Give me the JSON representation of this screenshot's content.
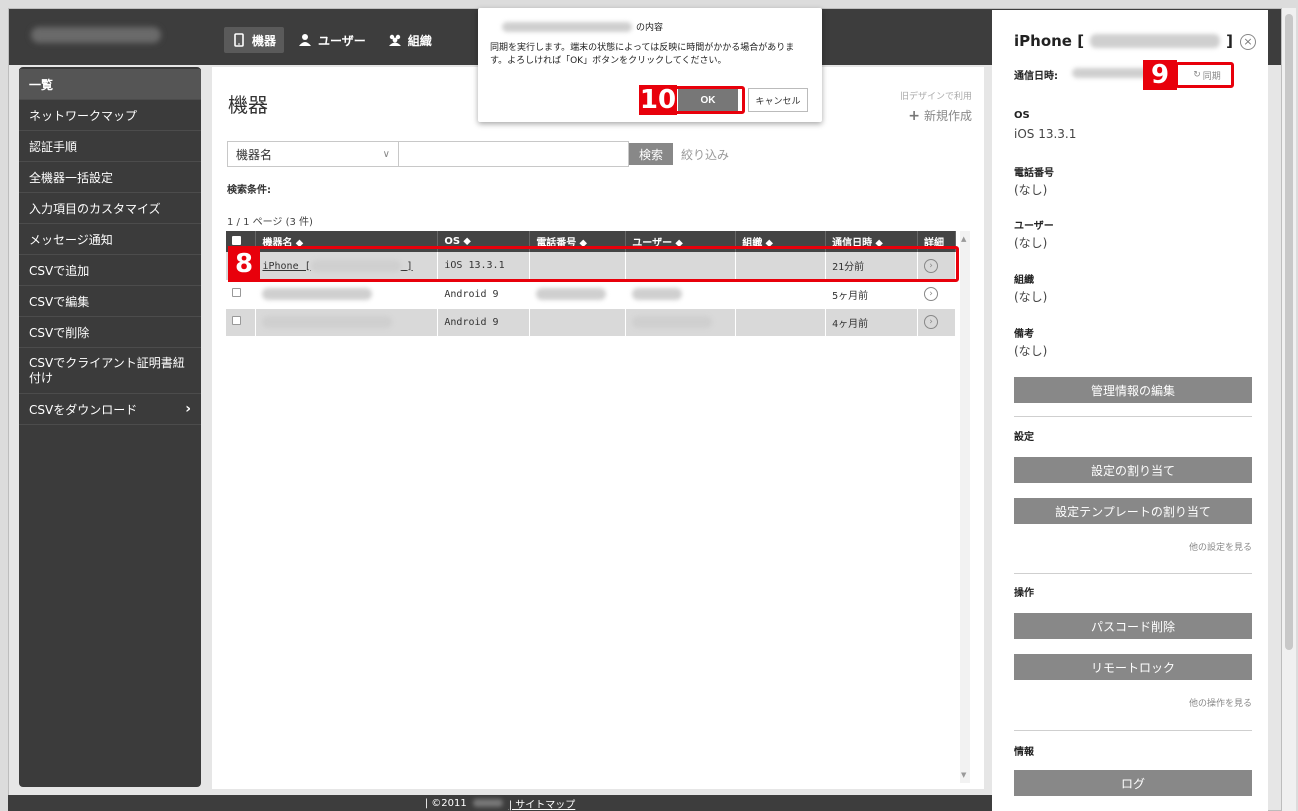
{
  "topnav": {
    "tabs": [
      {
        "label": "機器",
        "icon": "phone-icon",
        "active": true
      },
      {
        "label": "ユーザー",
        "icon": "person-icon",
        "active": false
      },
      {
        "label": "組織",
        "icon": "group-icon",
        "active": false
      }
    ]
  },
  "sidebar": {
    "items": [
      {
        "label": "一覧"
      },
      {
        "label": "ネットワークマップ"
      },
      {
        "label": "認証手順"
      },
      {
        "label": "全機器一括設定"
      },
      {
        "label": "入力項目のカスタマイズ"
      },
      {
        "label": "メッセージ通知"
      },
      {
        "label": "CSVで追加"
      },
      {
        "label": "CSVで編集"
      },
      {
        "label": "CSVで削除"
      },
      {
        "label": "CSVでクライアント証明書紐付け"
      },
      {
        "label": "CSVをダウンロード"
      }
    ]
  },
  "main": {
    "title": "機器",
    "legacy_link": "旧デザインで利用",
    "new_link": "新規作成",
    "search": {
      "field_select": "機器名",
      "button": "検索",
      "filter": "絞り込み"
    },
    "condition_label": "検索条件:",
    "pager": "1 / 1 ページ (3 件)"
  },
  "table": {
    "headers": [
      "機器名 ⬥",
      "OS ⬥",
      "電話番号 ⬥",
      "ユーザー ⬥",
      "組織 ⬥",
      "通信日時 ⬥",
      "詳細"
    ],
    "rows": [
      {
        "name_prefix": "iPhone [",
        "name_suffix": "]",
        "os": "iOS 13.3.1",
        "last_comm": "21分前"
      },
      {
        "name_prefix": "",
        "name_suffix": "",
        "os": "Android 9",
        "last_comm": "5ヶ月前"
      },
      {
        "name_prefix": "",
        "name_suffix": "",
        "os": "Android 9",
        "last_comm": "4ヶ月前"
      }
    ]
  },
  "dialog": {
    "title_suffix": "の内容",
    "message": "同期を実行します。端末の状態によっては反映に時間がかかる場合があります。よろしければ「OK」ボタンをクリックしてください。",
    "ok": "OK",
    "cancel": "キャンセル"
  },
  "panel": {
    "title_prefix": "iPhone [",
    "title_suffix": "]",
    "last_comm_label": "通信日時:",
    "sync": "同期",
    "os_label": "OS",
    "os_value": "iOS 13.3.1",
    "phone_label": "電話番号",
    "phone_value": "(なし)",
    "user_label": "ユーザー",
    "user_value": "(なし)",
    "org_label": "組織",
    "org_value": "(なし)",
    "note_label": "備考",
    "note_value": "(なし)",
    "edit_button": "管理情報の編集",
    "settings_label": "設定",
    "assign_settings": "設定の割り当て",
    "assign_template": "設定テンプレートの割り当て",
    "more_settings": "他の設定を見る",
    "ops_label": "操作",
    "passcode_delete": "パスコード削除",
    "remote_lock": "リモートロック",
    "more_ops": "他の操作を見る",
    "info_label": "情報",
    "log_button": "ログ"
  },
  "footer": {
    "copyright": "| ©2011",
    "sitemap": "| サイトマップ"
  },
  "callouts": {
    "step8": "8",
    "step9": "9",
    "step10": "10"
  },
  "colors": {
    "accent": "#e8000b",
    "topbar": "#3d3d3d",
    "sidebar": "#3b3b3b",
    "button": "#888888"
  }
}
